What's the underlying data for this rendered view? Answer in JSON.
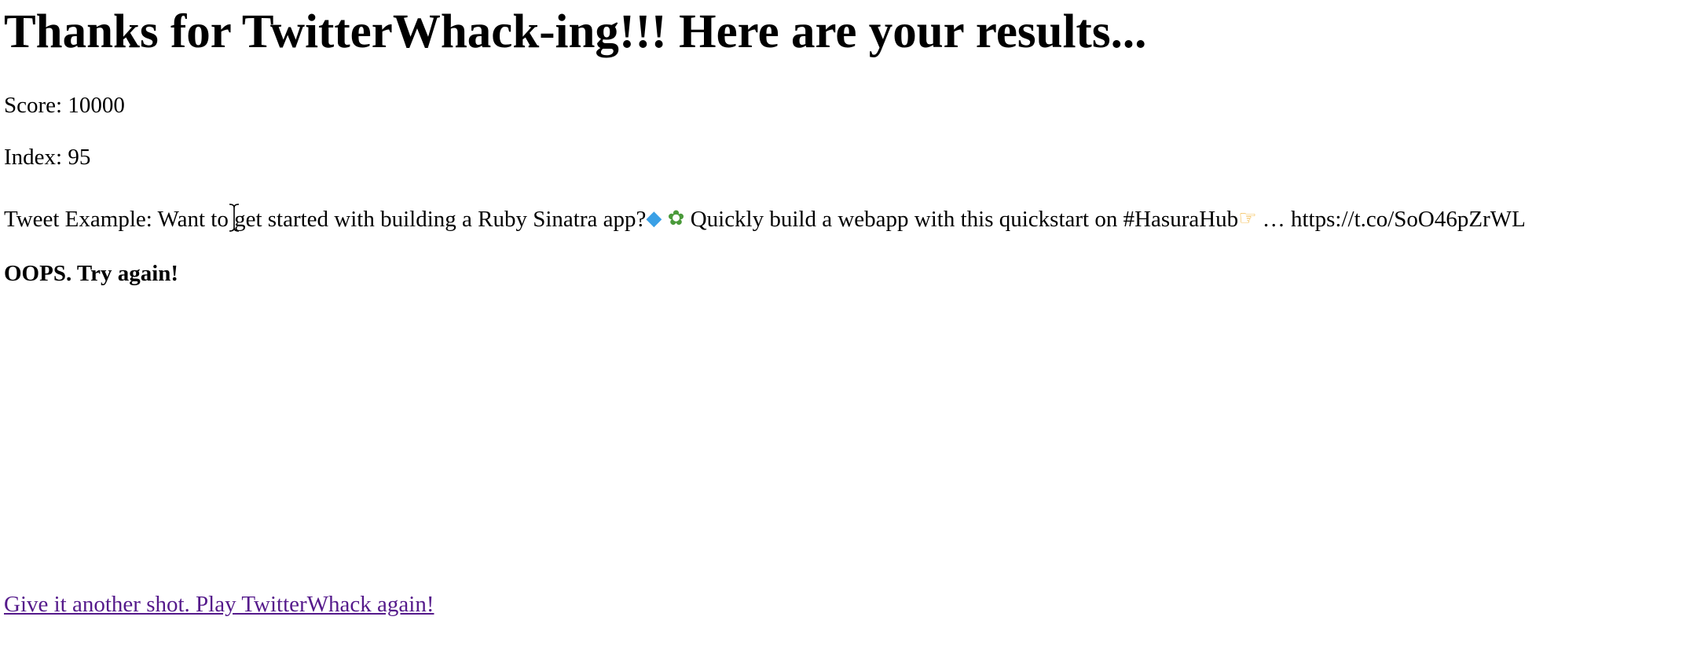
{
  "results": {
    "heading": "Thanks for TwitterWhack-ing!!! Here are your results...",
    "score_label": "Score: 10000",
    "index_label": "Index: 95",
    "tweet_prefix": "Tweet Example: Want to get started with building a Ruby Sinatra app?",
    "tweet_icon_1": "gem-icon",
    "tweet_icon_2": "sprout-icon",
    "tweet_middle": " Quickly build a webapp with this quickstart on #HasuraHub",
    "tweet_icon_3": "pointing-hand-icon",
    "tweet_suffix": " … https://t.co/SoO46pZrWL",
    "status_message": "OOPS. Try again!"
  },
  "actions": {
    "play_again_label": "Give it another shot. Play TwitterWhack again!"
  },
  "colors": {
    "visited_link": "#551a8b",
    "text": "#000000",
    "background": "#ffffff"
  }
}
